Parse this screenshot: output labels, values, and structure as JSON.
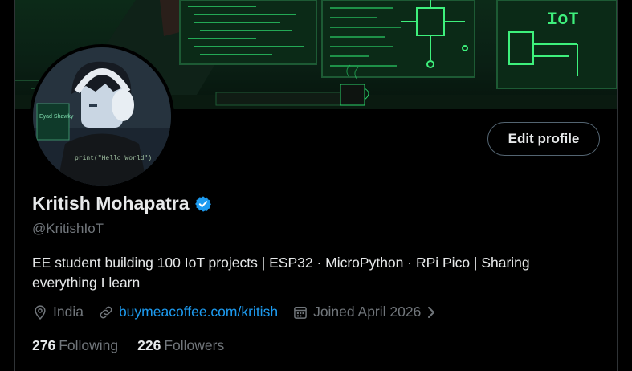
{
  "banner": {
    "sign_text": "IoT",
    "accent_color": "#2bd46a"
  },
  "avatar": {
    "nameplate": "Eyad Shawky",
    "shirt_text": "print(\"Hello World\")"
  },
  "profile": {
    "edit_button_label": "Edit profile",
    "display_name": "Kritish Mohapatra",
    "verified_badge_color": "#1d9bf0",
    "handle": "@KritishIoT",
    "bio": "EE student building 100 IoT projects | ESP32 · MicroPython · RPi Pico | Sharing everything I learn",
    "location": "India",
    "website": "buymeacoffee.com/kritish",
    "joined": "Joined April 2026"
  },
  "stats": {
    "following_count": "276",
    "following_label": "Following",
    "followers_count": "226",
    "followers_label": "Followers"
  },
  "icons": [
    "location-pin-icon",
    "link-icon",
    "calendar-icon",
    "chevron-right-icon",
    "verified-badge-icon"
  ]
}
